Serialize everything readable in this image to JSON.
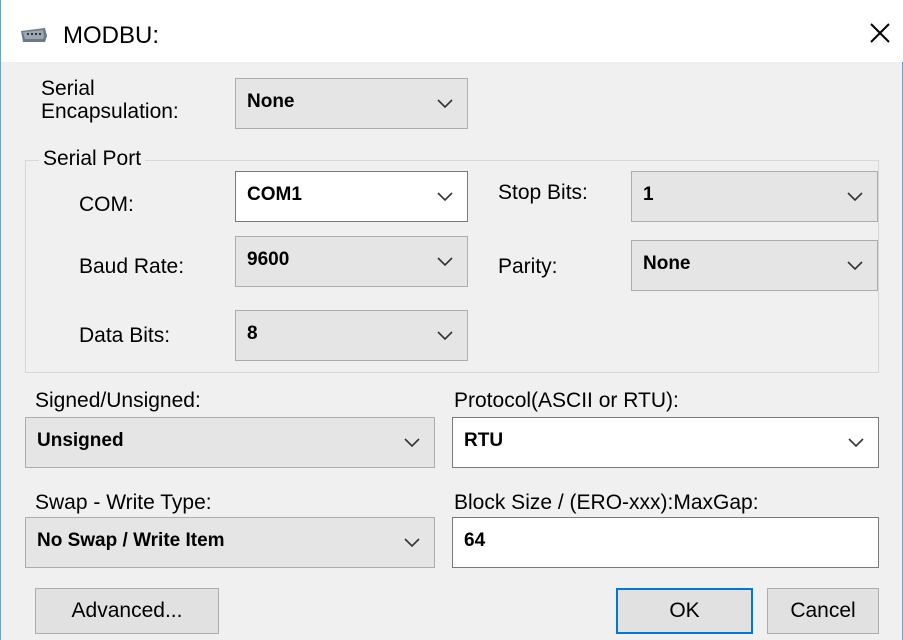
{
  "window": {
    "title": "MODBU:",
    "close_icon": "close-icon"
  },
  "serial_encapsulation": {
    "label_line1": "Serial",
    "label_line2": "Encapsulation:",
    "value": "None"
  },
  "serial_port": {
    "legend": "Serial Port",
    "com": {
      "label": "COM:",
      "value": "COM1"
    },
    "baud_rate": {
      "label": "Baud Rate:",
      "value": "9600"
    },
    "data_bits": {
      "label": "Data Bits:",
      "value": "8"
    },
    "stop_bits": {
      "label": "Stop Bits:",
      "value": "1"
    },
    "parity": {
      "label": "Parity:",
      "value": "None"
    }
  },
  "signed": {
    "label": "Signed/Unsigned:",
    "value": "Unsigned"
  },
  "protocol": {
    "label": "Protocol(ASCII or RTU):",
    "value": "RTU"
  },
  "swap": {
    "label": "Swap - Write Type:",
    "value": "No Swap / Write Item"
  },
  "block_size": {
    "label": "Block Size / (ERO-xxx):MaxGap:",
    "value": "64"
  },
  "buttons": {
    "advanced": "Advanced...",
    "ok": "OK",
    "cancel": "Cancel"
  },
  "colors": {
    "accent": "#0078d7",
    "combo_bg": "#e5e5e5",
    "window_bg": "#f0f0f0"
  }
}
